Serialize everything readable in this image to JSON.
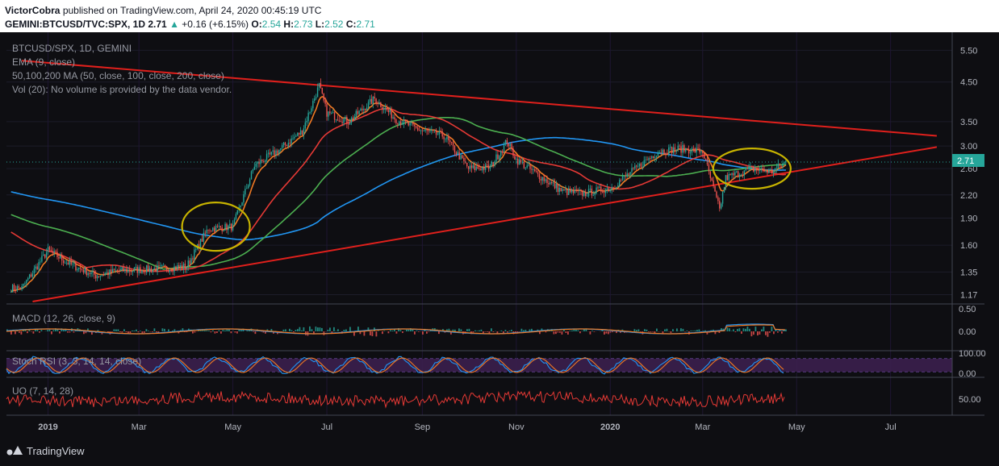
{
  "header": {
    "author": "VictorCobra",
    "published_text": "published on TradingView.com, April 24, 2020 00:45:19 UTC",
    "symbol": "GEMINI:BTCUSD/TVC:SPX, 1D",
    "last": "2.71",
    "change": "+0.16 (+6.15%)",
    "o_label": "O:",
    "o": "2.54",
    "h_label": "H:",
    "h": "2.73",
    "l_label": "L:",
    "l": "2.52",
    "c_label": "C:",
    "c": "2.71"
  },
  "legend": {
    "main": "BTCUSD/SPX, 1D, GEMINI",
    "ema": "EMA (9, close)",
    "ma": "50,100,200 MA (50, close, 100, close, 200, close)",
    "vol": "Vol (20): No volume is provided by the data vendor.",
    "macd": "MACD (12, 26, close, 9)",
    "stoch": "Stoch RSI (3, 3, 14, 14, close)",
    "uo": "UO (7, 14, 28)"
  },
  "price_badge": "2.71",
  "footer": {
    "brand": "TradingView"
  },
  "colors": {
    "background": "#0e0e12",
    "up_candle": "#26a69a",
    "down_candle": "#ef5350",
    "trendline": "#e0201c",
    "ema9": "#f07a24",
    "ma50": "#e53935",
    "ma100": "#4caf50",
    "ma200": "#2196f3",
    "ellipse": "#c8b400",
    "stoch_band": "#3b1f4e",
    "uo_line": "#e53935"
  },
  "chart_data": {
    "type": "candlestick",
    "scale": "log",
    "x_labels": [
      "2019",
      "Mar",
      "May",
      "Jul",
      "Sep",
      "Nov",
      "2020",
      "Mar",
      "May",
      "Jul"
    ],
    "y_ticks": [
      "5.50",
      "4.50",
      "3.50",
      "3.00",
      "2.60",
      "2.20",
      "1.90",
      "1.60",
      "1.35",
      "1.17"
    ],
    "y_range": [
      1.12,
      5.8
    ],
    "price_series": {
      "dates": [
        "2018-12-15",
        "2019-01-01",
        "2019-01-15",
        "2019-02-01",
        "2019-02-15",
        "2019-03-01",
        "2019-03-15",
        "2019-04-01",
        "2019-04-15",
        "2019-05-01",
        "2019-05-15",
        "2019-06-01",
        "2019-06-15",
        "2019-06-26",
        "2019-07-01",
        "2019-07-15",
        "2019-08-01",
        "2019-08-15",
        "2019-09-01",
        "2019-09-15",
        "2019-10-01",
        "2019-10-15",
        "2019-10-26",
        "2019-11-01",
        "2019-11-15",
        "2019-12-01",
        "2019-12-15",
        "2020-01-01",
        "2020-01-15",
        "2020-02-01",
        "2020-02-15",
        "2020-03-01",
        "2020-03-12",
        "2020-03-16",
        "2020-04-01",
        "2020-04-15",
        "2020-04-24"
      ],
      "values": [
        1.22,
        1.55,
        1.42,
        1.32,
        1.36,
        1.37,
        1.38,
        1.4,
        1.78,
        1.8,
        2.65,
        2.95,
        3.3,
        4.4,
        3.7,
        3.5,
        4.05,
        3.55,
        3.3,
        3.2,
        2.6,
        2.62,
        3.1,
        2.75,
        2.5,
        2.25,
        2.22,
        2.3,
        2.55,
        2.9,
        2.95,
        2.9,
        2.0,
        2.45,
        2.6,
        2.55,
        2.71
      ]
    },
    "annotations": [
      {
        "type": "trendline",
        "points": [
          [
            "2018-12-15",
            5.15
          ],
          [
            "2020-07-31",
            3.2
          ]
        ]
      },
      {
        "type": "trendline",
        "points": [
          [
            "2018-12-22",
            1.12
          ],
          [
            "2020-07-31",
            2.98
          ]
        ]
      },
      {
        "type": "ellipse",
        "center": [
          "2019-04-20",
          1.8
        ]
      },
      {
        "type": "ellipse",
        "center": [
          "2020-04-02",
          2.6
        ]
      }
    ],
    "macd_ticks": [
      "0.50",
      "0.00"
    ],
    "stoch_ticks": [
      "100.00",
      "0.00"
    ],
    "uo_ticks": [
      "50.00"
    ]
  }
}
